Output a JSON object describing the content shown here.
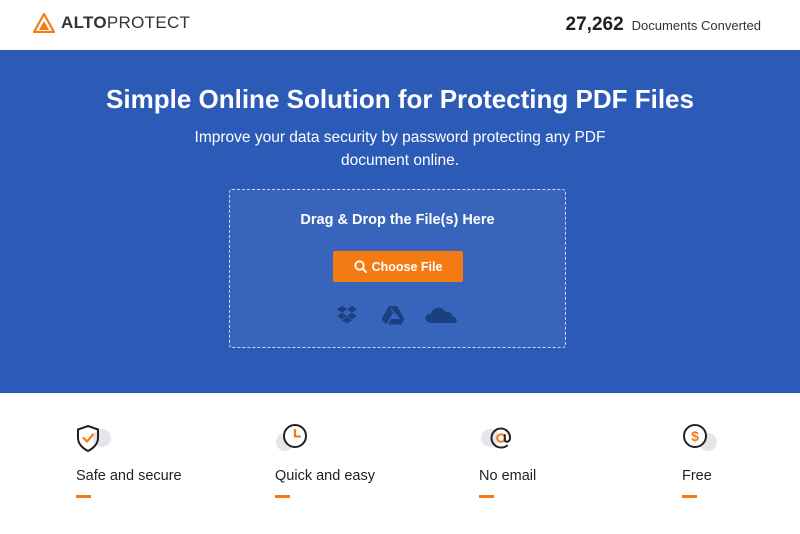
{
  "header": {
    "logo_bold": "ALTO",
    "logo_light": "PROTECT",
    "counter_value": "27,262",
    "counter_label": "Documents Converted",
    "accent_color": "#f47a14"
  },
  "hero": {
    "title": "Simple Online Solution for Protecting PDF Files",
    "subtitle": "Improve your data security by password protecting any PDF document online.",
    "background_color": "#2c5bb7",
    "dropzone": {
      "label": "Drag & Drop the File(s) Here",
      "button_label": "Choose File",
      "button_icon": "search-icon",
      "cloud_sources": [
        "dropbox-icon",
        "google-drive-icon",
        "onedrive-icon"
      ]
    }
  },
  "features": [
    {
      "icon": "shield-check-icon",
      "label": "Safe and secure"
    },
    {
      "icon": "clock-icon",
      "label": "Quick and easy"
    },
    {
      "icon": "at-sign-icon",
      "label": "No email"
    },
    {
      "icon": "dollar-icon",
      "label": "Free"
    }
  ]
}
